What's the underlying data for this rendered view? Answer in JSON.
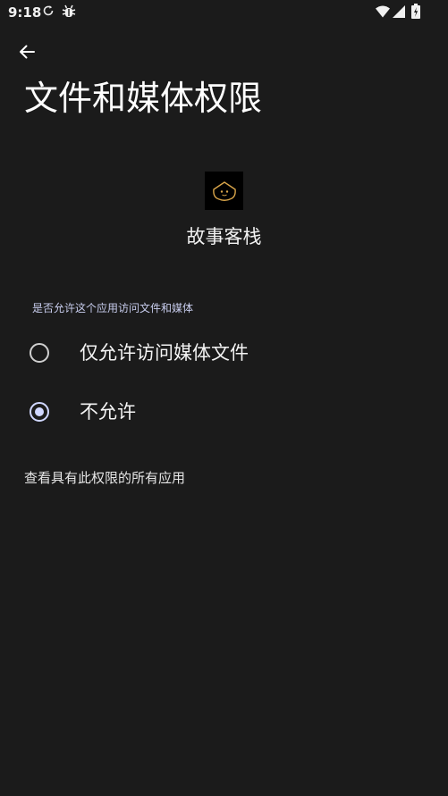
{
  "status_bar": {
    "time": "9:18",
    "icons": [
      "sync-icon",
      "bug-icon",
      "wifi-icon",
      "cellular-signal-icon",
      "battery-charging-icon"
    ]
  },
  "header": {
    "back_icon": "arrow-left-icon",
    "title": "文件和媒体权限"
  },
  "app": {
    "name": "故事客栈",
    "icon": "app-icon-house-face"
  },
  "permission": {
    "question": "是否允许这个应用访问文件和媒体",
    "options": [
      {
        "label": "仅允许访问媒体文件",
        "selected": false
      },
      {
        "label": "不允许",
        "selected": true
      }
    ]
  },
  "footer": {
    "see_all_link": "查看具有此权限的所有应用"
  },
  "colors": {
    "background": "#1b1b1b",
    "accent": "#d0d7ff",
    "section_label": "#c8cdee",
    "app_icon_stroke": "#d9a54a"
  }
}
